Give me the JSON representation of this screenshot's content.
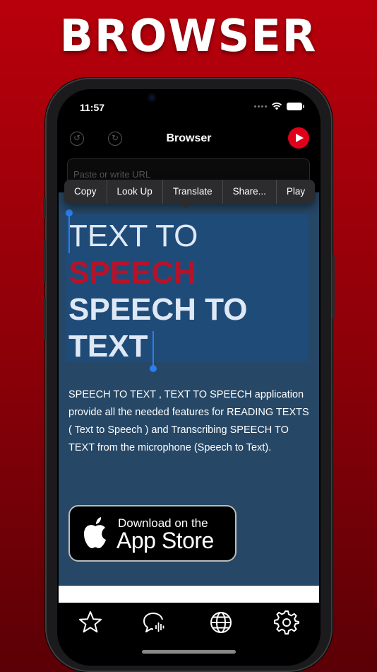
{
  "promo": {
    "title": "BROWSER"
  },
  "status_bar": {
    "time": "11:57"
  },
  "nav": {
    "title": "Browser"
  },
  "url_field": {
    "placeholder": "Paste or write URL"
  },
  "context_menu": {
    "items": [
      "Copy",
      "Look Up",
      "Translate",
      "Share...",
      "Play"
    ]
  },
  "content": {
    "line1": "TEXT TO",
    "line2": "SPEECH",
    "line3": "SPEECH TO",
    "line4": "TEXT",
    "paragraph": "SPEECH TO TEXT , TEXT TO SPEECH application provide all the needed features for READING TEXTS ( Text to Speech ) and Transcribing SPEECH TO TEXT from the microphone (Speech to Text).",
    "badge_small": "Download on the",
    "badge_big": "App Store"
  },
  "tabs": [
    "star-icon",
    "speech-bubble-icon",
    "globe-icon",
    "gear-icon"
  ],
  "colors": {
    "accent": "#e0001b",
    "selection": "#2c7df0",
    "page_bg": "#264765"
  }
}
